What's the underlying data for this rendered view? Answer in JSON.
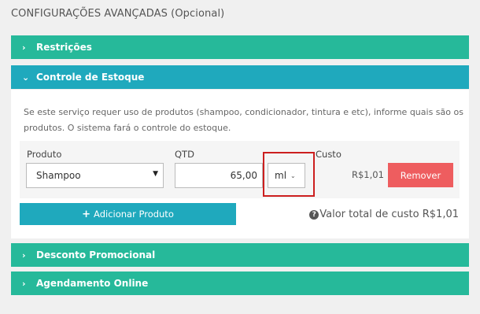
{
  "section_title": "CONFIGURAÇÕES AVANÇADAS (Opcional)",
  "panels": {
    "restricoes": "Restrições",
    "controle_estoque": "Controle de Estoque",
    "desconto": "Desconto Promocional",
    "agendamento": "Agendamento Online"
  },
  "estoque": {
    "description": "Se este serviço requer uso de produtos (shampoo, condicionador, tintura e etc), informe quais são os produtos. O sistema fará o controle do estoque.",
    "labels": {
      "produto": "Produto",
      "qtd": "QTD",
      "custo": "Custo"
    },
    "row": {
      "produto": "Shampoo",
      "qtd": "65,00",
      "unidade": "ml",
      "custo": "R$1,01",
      "remove_label": "Remover"
    },
    "add_label": "Adicionar Produto",
    "total_label": "Valor total de custo R$1,01"
  },
  "colors": {
    "green": "#26b99a",
    "teal": "#1fa9bd",
    "remove": "#ee5d5f",
    "highlight": "#cc1f1f"
  }
}
